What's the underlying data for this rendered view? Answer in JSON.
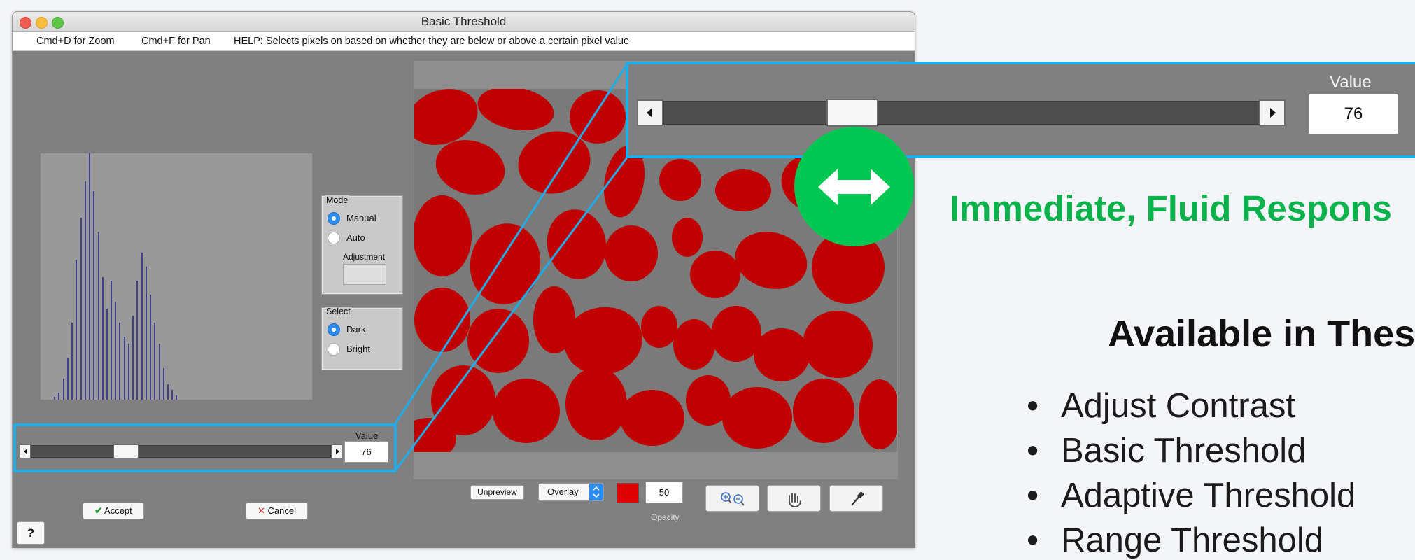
{
  "window": {
    "title": "Basic Threshold",
    "menu": [
      "Cmd+D for Zoom",
      "Cmd+F for Pan",
      "HELP:  Selects pixels on based on whether they are below or above a certain pixel value"
    ]
  },
  "mode_group": {
    "title": "Mode",
    "options": [
      {
        "label": "Manual",
        "selected": true
      },
      {
        "label": "Auto",
        "selected": false
      }
    ],
    "adjustment_label": "Adjustment"
  },
  "select_group": {
    "title": "Select",
    "options": [
      {
        "label": "Dark",
        "selected": true
      },
      {
        "label": "Bright",
        "selected": false
      }
    ]
  },
  "slider": {
    "value_label": "Value",
    "value": "76",
    "fraction": 0.3
  },
  "buttons": {
    "accept": "Accept",
    "cancel": "Cancel",
    "help": "?",
    "unpreview": "Unpreview",
    "overlay_select": "Overlay",
    "opacity_value": "50",
    "opacity_label": "Opacity"
  },
  "toolbar_icons": [
    "zoom-in-icon",
    "zoom-out-icon",
    "hand-pan-icon",
    "eyedropper-icon"
  ],
  "colors": {
    "overlay_red": "#e00000",
    "callout_cyan": "#20ace6",
    "accent_green": "#00c853",
    "headline_green": "#0bb14a",
    "radio_blue": "#2d8cf0"
  },
  "zoom_callout": {
    "value_label": "Value",
    "value": "76"
  },
  "slide": {
    "headline": "Immediate, Fluid Respons",
    "subheading": "Available in Thes",
    "bullets": [
      "Adjust Contrast",
      "Basic Threshold",
      "Adaptive Threshold",
      "Range Threshold"
    ]
  }
}
